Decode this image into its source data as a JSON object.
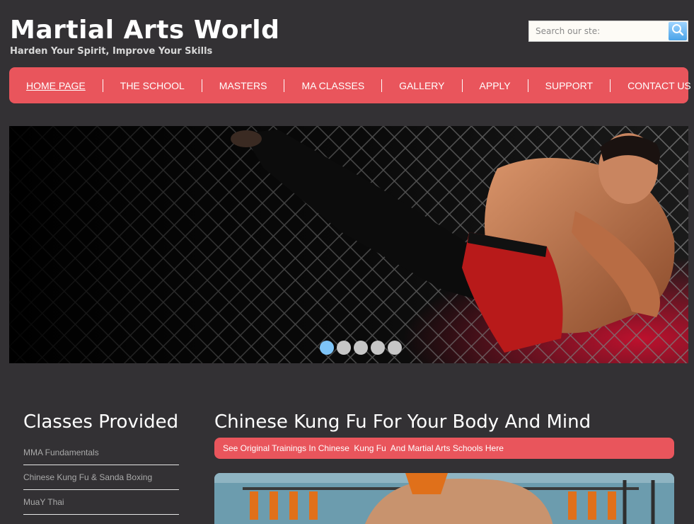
{
  "header": {
    "title": "Martial Arts World",
    "tagline": "Harden Your Spirit, Improve Your Skills"
  },
  "search": {
    "placeholder": "Search our ste:",
    "icon": "search-icon"
  },
  "nav": {
    "items": [
      {
        "label": "HOME PAGE",
        "active": true
      },
      {
        "label": "THE SCHOOL"
      },
      {
        "label": "MASTERS"
      },
      {
        "label": "MA CLASSES"
      },
      {
        "label": "GALLERY"
      },
      {
        "label": "APPLY"
      },
      {
        "label": "SUPPORT"
      },
      {
        "label": "CONTACT US"
      }
    ]
  },
  "slider": {
    "dot_count": 5,
    "active_index": 0
  },
  "sidebar": {
    "title": "Classes Provided",
    "items": [
      "MMA Fundamentals",
      "Chinese Kung Fu & Sanda Boxing",
      "MuaY Thai"
    ]
  },
  "main": {
    "heading": "Chinese Kung Fu For Your Body And Mind",
    "banner": "See Original Trainings In Chinese  Kung Fu  And Martial Arts Schools Here"
  },
  "colors": {
    "background": "#333134",
    "accent": "#e9555c",
    "active_dot": "#7ec4f7",
    "inactive_dot": "#c6c6c6"
  }
}
